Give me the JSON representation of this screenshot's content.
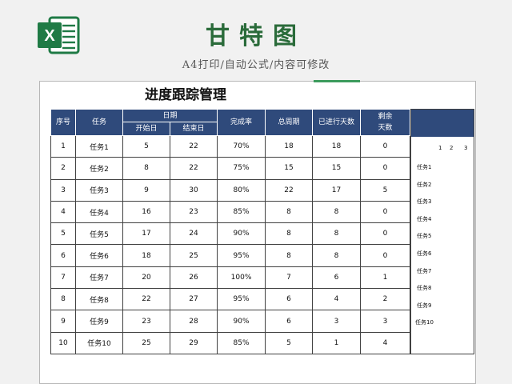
{
  "header": {
    "title": "甘特图",
    "subtitle": "A4打印/自动公式/内容可修改",
    "logo_letter": "X"
  },
  "sheet": {
    "title": "进度跟踪管理",
    "columns": {
      "seq": "序号",
      "task": "任务",
      "date": "日期",
      "start": "开始日",
      "end": "结束日",
      "rate": "完成率",
      "total": "总周期",
      "elapsed": "已进行天数",
      "remain_1": "剩余",
      "remain_2": "天数"
    },
    "rows": [
      {
        "seq": "1",
        "task": "任务1",
        "start": "5",
        "end": "22",
        "rate": "70%",
        "total": "18",
        "elapsed": "18",
        "remain": "0"
      },
      {
        "seq": "2",
        "task": "任务2",
        "start": "8",
        "end": "22",
        "rate": "75%",
        "total": "15",
        "elapsed": "15",
        "remain": "0"
      },
      {
        "seq": "3",
        "task": "任务3",
        "start": "9",
        "end": "30",
        "rate": "80%",
        "total": "22",
        "elapsed": "17",
        "remain": "5"
      },
      {
        "seq": "4",
        "task": "任务4",
        "start": "16",
        "end": "23",
        "rate": "85%",
        "total": "8",
        "elapsed": "8",
        "remain": "0"
      },
      {
        "seq": "5",
        "task": "任务5",
        "start": "17",
        "end": "24",
        "rate": "90%",
        "total": "8",
        "elapsed": "8",
        "remain": "0"
      },
      {
        "seq": "6",
        "task": "任务6",
        "start": "18",
        "end": "25",
        "rate": "95%",
        "total": "8",
        "elapsed": "8",
        "remain": "0"
      },
      {
        "seq": "7",
        "task": "任务7",
        "start": "20",
        "end": "26",
        "rate": "100%",
        "total": "7",
        "elapsed": "6",
        "remain": "1"
      },
      {
        "seq": "8",
        "task": "任务8",
        "start": "22",
        "end": "27",
        "rate": "95%",
        "total": "6",
        "elapsed": "4",
        "remain": "2"
      },
      {
        "seq": "9",
        "task": "任务9",
        "start": "23",
        "end": "28",
        "rate": "90%",
        "total": "6",
        "elapsed": "3",
        "remain": "3"
      },
      {
        "seq": "10",
        "task": "任务10",
        "start": "25",
        "end": "29",
        "rate": "85%",
        "total": "5",
        "elapsed": "1",
        "remain": "4"
      }
    ],
    "gantt_days": [
      "1",
      "2",
      "3"
    ],
    "gantt_tasks": [
      "任务1",
      "任务2",
      "任务3",
      "任务4",
      "任务5",
      "任务6",
      "任务7",
      "任务8",
      "任务9",
      "任务10"
    ]
  },
  "colors": {
    "brand_green": "#2a6b3a",
    "header_blue": "#2f4a7b",
    "excel_green": "#1f7a45"
  }
}
